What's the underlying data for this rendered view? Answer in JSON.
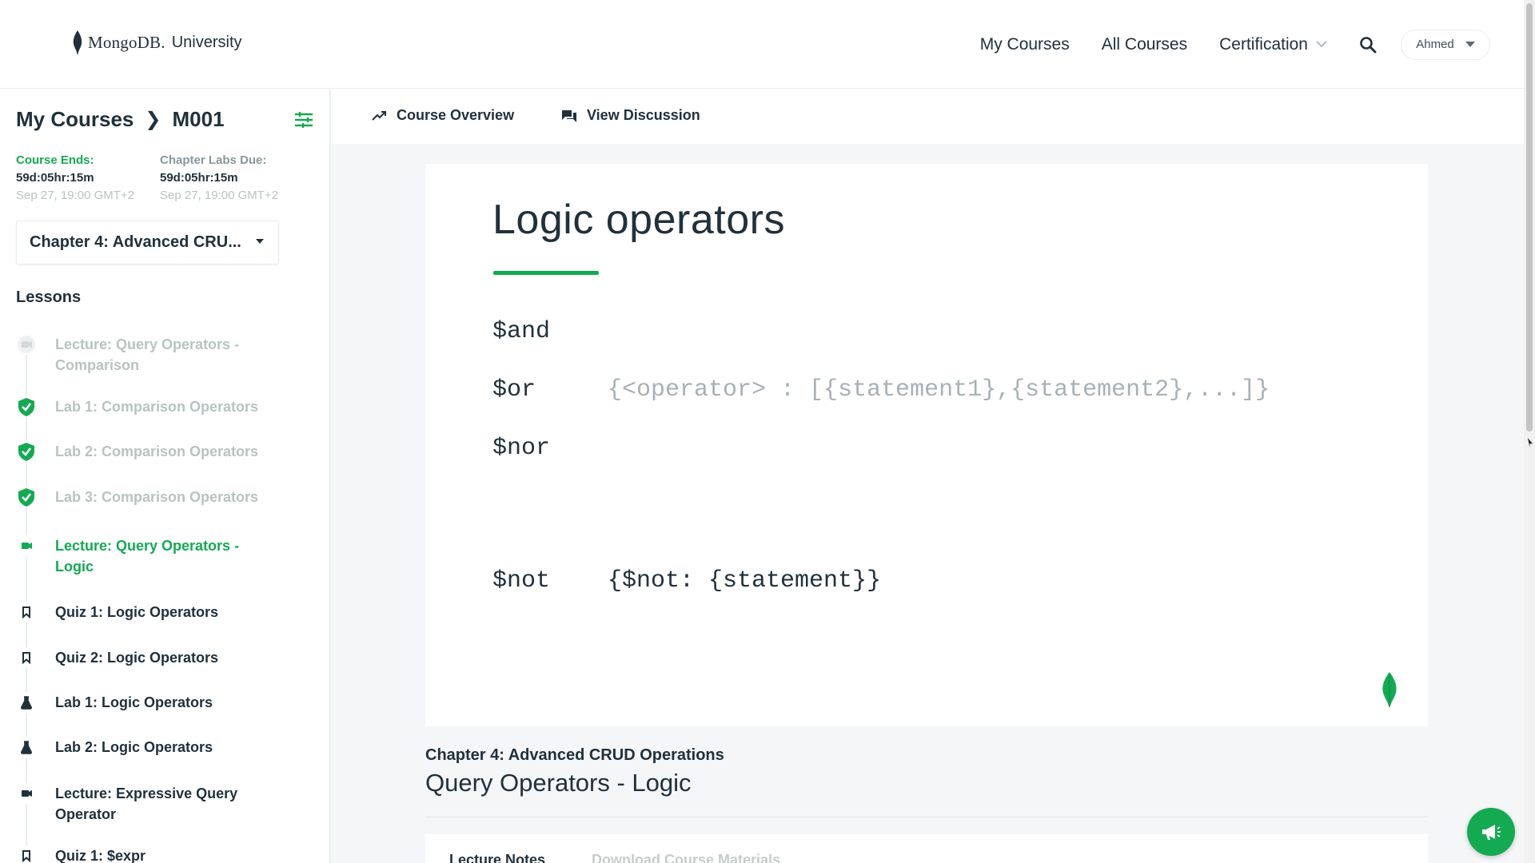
{
  "header": {
    "brand_name": "MongoDB.",
    "brand_sub": "University",
    "nav": {
      "my_courses": "My Courses",
      "all_courses": "All Courses",
      "certification": "Certification"
    },
    "user_name": "Ahmed"
  },
  "sidebar": {
    "breadcrumb_root": "My Courses",
    "breadcrumb_sep": "❯",
    "breadcrumb_course": "M001",
    "course_ends": {
      "label": "Course Ends:",
      "countdown": "59d:05hr:15m",
      "date": "Sep 27, 19:00 GMT+2"
    },
    "labs_due": {
      "label": "Chapter Labs Due:",
      "countdown": "59d:05hr:15m",
      "date": "Sep 27, 19:00 GMT+2"
    },
    "chapter_selected": "Chapter 4: Advanced CRU...",
    "lessons_title": "Lessons",
    "lessons": [
      {
        "label": "Lecture: Query Operators - Comparison",
        "icon": "video-icon",
        "state": "done"
      },
      {
        "label": "Lab 1: Comparison Operators",
        "icon": "shield-check-icon",
        "state": "done"
      },
      {
        "label": "Lab 2: Comparison Operators",
        "icon": "shield-check-icon",
        "state": "done"
      },
      {
        "label": "Lab 3: Comparison Operators",
        "icon": "shield-check-icon",
        "state": "done"
      },
      {
        "label": "Lecture: Query Operators - Logic",
        "icon": "video-icon",
        "state": "active"
      },
      {
        "label": "Quiz 1: Logic Operators",
        "icon": "bookmark-icon",
        "state": "todo"
      },
      {
        "label": "Quiz 2: Logic Operators",
        "icon": "bookmark-icon",
        "state": "todo"
      },
      {
        "label": "Lab 1: Logic Operators",
        "icon": "flask-icon",
        "state": "todo"
      },
      {
        "label": "Lab 2: Logic Operators",
        "icon": "flask-icon",
        "state": "todo"
      },
      {
        "label": "Lecture: Expressive Query Operator",
        "icon": "video-icon",
        "state": "todo"
      },
      {
        "label": "Quiz 1: $expr",
        "icon": "bookmark-icon",
        "state": "todo"
      }
    ]
  },
  "main": {
    "tabs": {
      "overview": "Course Overview",
      "discussion": "View Discussion"
    },
    "slide": {
      "title": "Logic operators",
      "and": "$and",
      "or": "$or",
      "or_syntax": "{<operator> : [{statement1},{statement2},...]}",
      "nor": "$nor",
      "not": "$not",
      "not_syntax": "{$not: {statement}}"
    },
    "chapter_caption": "Chapter 4: Advanced CRUD Operations",
    "lesson_heading": "Query Operators - Logic",
    "notes_tabs": {
      "lecture_notes": "Lecture Notes",
      "download": "Download Course Materials"
    }
  },
  "colors": {
    "accent": "#13aa52",
    "text": "#21313c",
    "muted": "#b8c4c2"
  }
}
